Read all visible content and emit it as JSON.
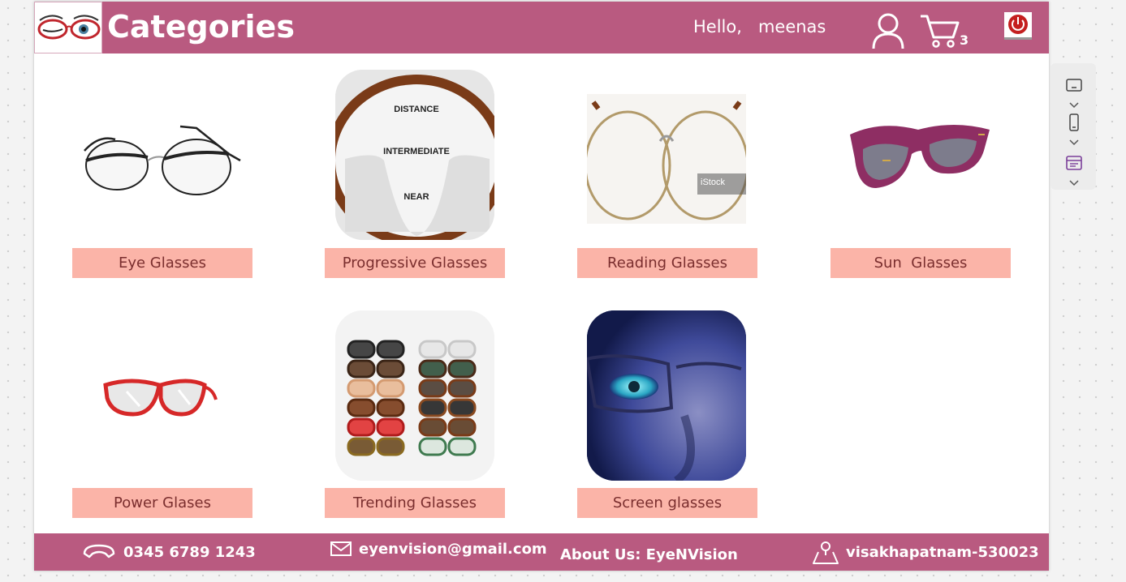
{
  "header": {
    "title": "Categories",
    "greeting": "Hello,",
    "username": "meenas",
    "cart_count": "3",
    "bg_color": "#b95a80"
  },
  "categories": [
    {
      "label": "Eye Glasses",
      "image": "metal-frame-eyeglasses"
    },
    {
      "label": "Progressive Glasses",
      "image": "progressive-lens-zones",
      "zones": [
        "DISTANCE",
        "INTERMEDIATE",
        "NEAR"
      ]
    },
    {
      "label": "Reading Glasses",
      "image": "round-wire-reading-glasses",
      "watermark": "iStock"
    },
    {
      "label": "Sun  Glasses",
      "image": "pink-sunglasses"
    },
    {
      "label": "Power Glases",
      "image": "red-power-glasses"
    },
    {
      "label": "Trending Glasses",
      "image": "assorted-glasses-grid"
    },
    {
      "label": "Screen glasses",
      "image": "screen-glasses-face"
    }
  ],
  "footer": {
    "phone": "0345 6789 1243",
    "email": "eyenvision@gmail.com",
    "about": "About Us: EyeNVision",
    "location": "visakhapatnam-530023"
  },
  "side_panel": {
    "icons": [
      "tablet-landscape-icon",
      "phone-portrait-icon",
      "web-layout-icon"
    ]
  },
  "colors": {
    "label_bg": "#fbb4a8",
    "label_text": "#7a2e2e",
    "accent": "#b95a80"
  }
}
